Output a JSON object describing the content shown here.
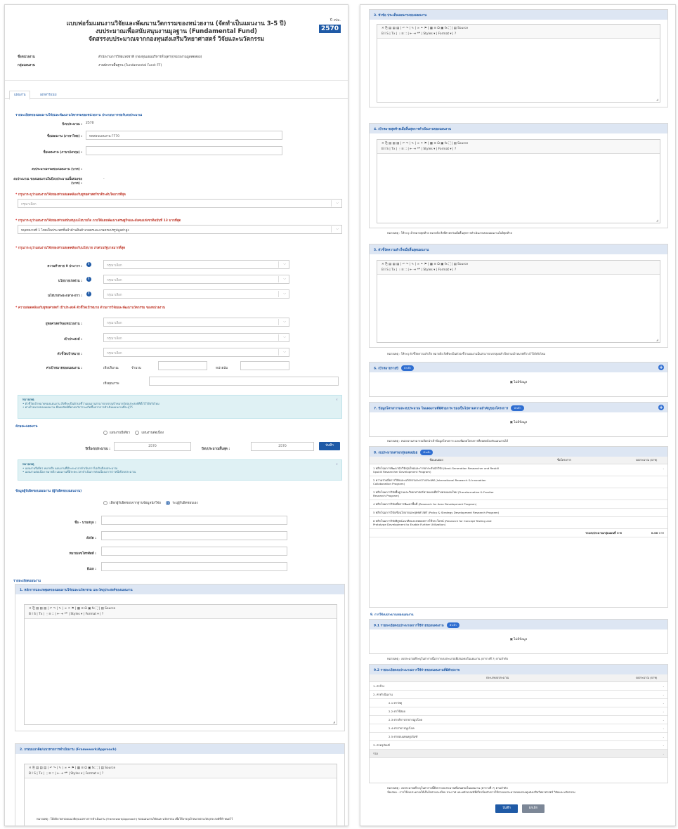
{
  "form": {
    "title1": "แบบฟอร์มแผนงานวิจัยและพัฒนานวัตกรรมของหน่วยงาน (จัดทำเป็นแผนงาน 3-5 ปี)",
    "title2": "งบประมาณเพื่อสนับสนุนงานมูลฐาน (Fundamental Fund)",
    "title3": "จัดสรรงบประมาณจากกองทุนส่งเสริมวิทยาศาสตร์ วิจัยและนวัตกรรม",
    "year_label": "ปี งปม.",
    "year_value": "2570",
    "agency_label": "ชื่อหน่วยงาน",
    "agency_value": "สำนักงานการวิจัยแห่งชาติ (กองทุนแผนบริหารทั่วอุตฯ)(หน่วยงานมูลทดสอบ)",
    "group_label": "กลุ่มแผนงาน",
    "group_value": "งานนักงานพื้นฐาน (Fundamental Fund: FF)"
  },
  "tabs": [
    "แผนงาน",
    "เอกสารแนบ"
  ],
  "basic": {
    "section": "รายละเอียดของแผนงานวิจัยและพัฒนานวัตกรรมของหน่วยงาน ประกอบการขอรับงบประมาณ",
    "year_label": "ปีงบประมาณ :",
    "year_value": "2570",
    "name_th_label": "ชื่อแผนงาน (ภาษาไทย) :",
    "name_th_value": "ทดสอบแผนงาน FF70",
    "name_en_label": "ชื่อแผนงาน (ภาษาอังกฤษ) :",
    "budget_label": "งบประมาณรวมของแผนงาน (บาท) :",
    "budget_year_label": "งบประมาณ ของแผนงานในปีงบประมาณนี้เสนอขอ (บาท) :",
    "budget_year_value": "-"
  },
  "strategy": {
    "q1": "กรุณาระบุว่าแผนงานวิจัยของท่านสอดคล้องกับยุทธศาสตร์ชาติระดับใดมากที่สุด",
    "q1_value": "กรุณาเลือก",
    "q2": "กรุณาระบุว่าแผนงานวิจัยของท่านสนับสนุนนโยบายใด ภายใต้แผนพัฒนาเศรษฐกิจและสังคมแห่งชาติฉบับที่ 13 มากที่สุด",
    "q2_value": "หมุดหมายที่ 1 ไทยเป็นประเทศชั้นนำด้านสินค้าเกษตรและเกษตรแปรรูปมูลค่าสูง",
    "q3": "กรุณาระบุว่าแผนงานวิจัยของท่านสอดคล้องกับนโยบาย เร่งด่วนรัฐบาลมากที่สุด",
    "f1_label": "ความท้าทาย 9 ประการ :",
    "f2_label": "นโยบายเร่งด่วน :",
    "f3_label": "นโยบายระยะกลาง-ยาว :",
    "placeholder": "กรุณาเลือก",
    "q4": "ความสอดคล้องกับยุทธศาสตร์ เป้าประสงค์ ตัวชี้วัดเป้าหมาย ด้านการวิจัยและพัฒนานวัตกรรม ของหน่วยงาน",
    "f4_label": "ยุทธศาสตร์ของหน่วยงาน :",
    "f5_label": "เป้าประสงค์ :",
    "f6_label": "ตัวชี้วัดเป้าหมาย :",
    "f7_label": "ค่าเป้าหมายของแผนงาน :",
    "qty_label": "เชิงปริมาณ",
    "amount_label": "จำนวน",
    "unit_label": "หน่วยนับ",
    "quality_label": "เชิงคุณภาพ"
  },
  "alert1": {
    "title": "หมายเหตุ",
    "line1": "ตัวชี้วัดเป้าหมายของแผนงาน สิ่งที่จะเป็นตัวบ่งชี้ว่าแผนงานสามารถบรรลุเป้าหมายวัตถุประสงค์ที่ตั้งไว้ได้จริงไหม",
    "line2": "ค่าเป้าหมายของแผนงาน คือผลลัพธ์ที่คาดหวังว่าจะเกิดขึ้นจากการดำเนินแผนงานที่ระบุไว้"
  },
  "duration": {
    "section": "ลักษณะแผนงาน",
    "opt1": "แผนงานปีเดียว",
    "opt2": "แผนงานต่อเนื่อง",
    "start_label": "ปีเริ่มงบประมาณ :",
    "start_value": "2570",
    "end_label": "ปีงบประมาณสิ้นสุด :",
    "end_value": "2570",
    "save": "บันทึก"
  },
  "alert2": {
    "title": "หมายเหตุ",
    "line1": "แผนงานปีเดียว หมายถึง แผนงานที่มีระยะเวลาดำเนินการไม่เกินปีงบประมาณ",
    "line2": "แผนงานต่อเนื่อง หมายถึง แผนงานที่มีระยะเวลาดำเนินการต่อเนื่องมากกว่าหนึ่งปีงบประมาณ"
  },
  "manager": {
    "section": "ข้อมูลผู้รับผิดชอบแผนงาน (ผู้รับผิดชอบแผนงาน)",
    "opt1": "เลือกผู้รับผิดชอบจากฐานข้อมูลนักวิจัย",
    "opt2": "ระบุผู้รับผิดชอบเอง",
    "name_label": "ชื่อ - นามสกุล :",
    "org_label": "สังกัด :",
    "phone_label": "หมายเลขโทรศัพท์ :",
    "email_label": "อีเมล :"
  },
  "details": {
    "section": "รายละเอียดแผนงาน",
    "p1": "1. หลักการและเหตุผลของแผนงานวิจัยและนวัตกรรม และวัตถุประสงค์ของแผนงาน",
    "p2": "2. กรอบแนวคิด/แนวทางการดำเนินงาน (Framework/Approach)",
    "note2": "หมายเหตุ : ให้อธิบายกรอบแนวคิด/แนวทางการดำเนินงาน (Framework/Approach) ของแผนงานวิจัยและนวัตกรรม เพื่อให้บรรลุเป้าหมายตามวัตถุประสงค์ที่กำหนดไว้",
    "p3": "3. หัวข้อ ประเด็นแผนงานของแผนงาน",
    "p4": "4. เป้าหมายสุดท้ายเมื่อสิ้นสุดการดำเนินงานของแผนงาน",
    "note4": "หมายเหตุ : ให้ระบุ เป้าหมายสุดท้าย หมายถึง สิ่งที่คาดหวังเมื่อสิ้นสุดการดำเนินงานของแผนงานในปีสุดท้าย",
    "p5": "5. ตัวชี้วัดความสำเร็จเมื่อสิ้นสุดแผนงาน",
    "note5": "หมายเหตุ : ให้ระบุ ตัวชี้วัดความสำเร็จ หมายถึง สิ่งที่จะเป็นตัวบ่งชี้ว่าแผนงานนั้นสามารถบรรลุผลสำเร็จตามเป้าหมายที่วางไว้ได้จริงไหม",
    "p6": "6. เป้าหมายรายปี",
    "p7": "7. ข้อมูลโครงการและงบประมาณ ในแผนงานที่มีศักยภาพ ของเป็นไปตามความสำคัญของโครงการ",
    "note7": "หมายเหตุ : หน่วยงานสามารถเลือกนำเข้าข้อมูลโครงการ และเพิ่มลดโครงการที่สอดคล้องกับแผนงานได้",
    "p8": "8. งบประมาณตามกลุ่มแผนย่อย",
    "p9": "9. การใช้งบประมาณของแผนงาน",
    "p91": "9.1 รายละเอียดงบประมาณการใช้จ่ายของแผนงาน",
    "note91": "หมายเหตุ : งบประมาณที่ระบุในตารางนี้มาจากงบประมาณที่เสนอขอในแผนงาน (ตารางที่ 7) ตามลำดับ",
    "p92": "9.2 รายละเอียดงบประมาณการใช้จ่ายของแผนงานที่มีศักยภาพ",
    "note9_1": "หมายเหตุ : งบประมาณที่ระบุในตารางนี้ดึงจากงบประมาณที่เสนอขอในแผนงาน (ตารางที่ 7) ตามลำดับ",
    "note9_2": "ข้อเสนอ : การใช้งบประมาณให้เป็นไปตามระเบียบ ประกาศ และหลักเกณฑ์ที่เกี่ยวข้องกับการใช้จ่ายงบประมาณของกองทุนส่งเสริมวิทยาศาสตร์ วิจัยและนวัตกรรม",
    "badge": "นำเข้า",
    "nodata": "ไม่มีข้อมูล"
  },
  "editor": {
    "toolbar1": "✕ ⎘ ▤ ▤ ▤ | ↶ ↷ | ✎ | ∞ ⚭ ⚑ | ▦ ≡ Ω ▣ fx ⛶ | ▤ Source",
    "toolbar2": "B I S | Tx | ⋮≡ ∷ | ⇤ ⇥ ❝❞ | Styles ▾ | Format ▾ | ?"
  },
  "table8": {
    "headers": [
      "ชื่อแผนย่อย",
      "ชื่อโครงการ",
      "งบประมาณ (บาท)"
    ],
    "rows": [
      [
        "1 พลิกโฉมการพัฒนานักวิจัยรุ่นใหม่และการยกระดับนักวิจัย (Next-Generation Researcher and Reskill Upskill Researcher Development Program)",
        "",
        "-"
      ],
      [
        "2 ความร่วมมือการวิจัยและนวัตกรรมระหว่างประเทศ (International Research & Innovation Collaboration Program)",
        "",
        ""
      ],
      [
        "3 พลิกโฉมการวิจัยพื้นฐานและวิทยาศาสตร์ชายแดนที่สร้างพรมแดนใหม่ (Transformative & Frontier Research Program)",
        "",
        ""
      ],
      [
        "4 พลิกโฉมการวิจัยเพื่อการพัฒนาพื้นที่ (Research for Area Development Program)",
        "",
        ""
      ],
      [
        "5 พลิกโฉมการวิจัยเชิงนโยบายและยุทธศาสตร์ (Policy & Strategy Development Research Program)",
        "",
        ""
      ],
      [
        "6 พลิกโฉมการวิจัยพิสูจน์แนวคิดและต่อยอดการใช้ประโยชน์ (Research for Concept Testing and Prototype Development to Enable Further Utilization)",
        "",
        ""
      ]
    ],
    "total_label": "รวมงบประมาณกลุ่มแผนที่ 3-6",
    "total_value": "0.00",
    "total_unit": "บาท"
  },
  "table92": {
    "headers": [
      "ประเภทงบประมาณ",
      "งบประมาณ (บาท)"
    ],
    "rows": [
      {
        "label": "1. ค่าจ้าง",
        "indent": 0,
        "value": "-"
      },
      {
        "label": "2. ค่าดำเนินงาน",
        "indent": 0,
        "value": "-"
      },
      {
        "label": "2.1 ค่าวัสดุ",
        "indent": 1,
        "value": "-"
      },
      {
        "label": "2.2 ค่าใช้สอย",
        "indent": 1,
        "value": "-"
      },
      {
        "label": "2.3 ค่าบริการสาธารณูปโภค",
        "indent": 1,
        "value": "-"
      },
      {
        "label": "2.4 ค่าสาธารณูปโภค",
        "indent": 1,
        "value": "-"
      },
      {
        "label": "2.5 ค่าตอบแทนคุรุภัณฑ์",
        "indent": 1,
        "value": "-"
      },
      {
        "label": "3. ค่าครุภัณฑ์",
        "indent": 0,
        "value": "-"
      },
      {
        "label": "รวม",
        "indent": 0,
        "value": "-"
      }
    ]
  },
  "footer": {
    "save": "บันทึก",
    "cancel": "ยกเลิก"
  },
  "colors": {
    "primary": "#1f5aa6",
    "panel_header": "#dde6f3",
    "alert": "#dff1f4"
  }
}
